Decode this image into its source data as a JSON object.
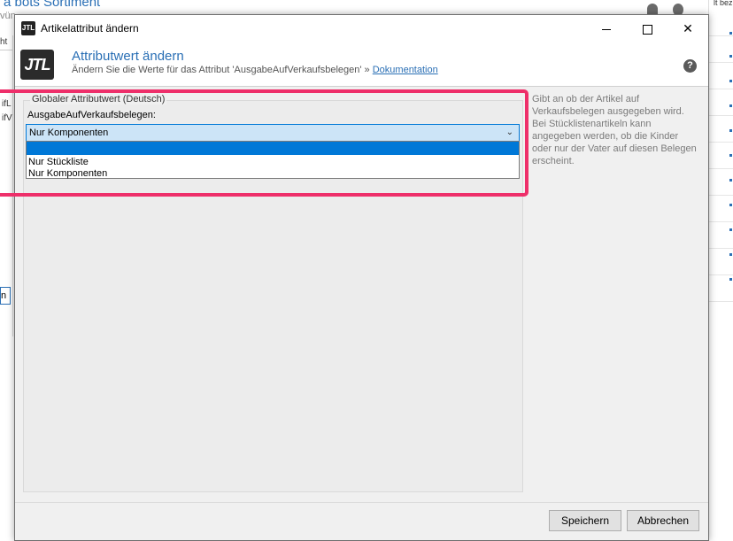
{
  "background": {
    "title": "a bots Sortiment",
    "subtitle": "vün",
    "left_button": "ht",
    "left_text_1": "ifL",
    "left_text_2": "ifV",
    "left_field": "n",
    "right_text": "lt bez"
  },
  "dialog": {
    "window_title": "Artikelattribut ändern",
    "logo_text": "JTL",
    "header": {
      "title": "Attributwert ändern",
      "subtitle": "Ändern Sie die Werte für das Attribut 'AusgabeAufVerkaufsbelegen'",
      "link_prefix": "»",
      "link": "Dokumentation"
    },
    "group_title": "Globaler Attributwert (Deutsch)",
    "field_label": "AusgabeAufVerkaufsbelegen:",
    "select": {
      "selected": "Nur Komponenten",
      "options": [
        "",
        "Nur Stückliste",
        "Nur Komponenten"
      ]
    },
    "description": "Gibt an ob der Artikel auf Verkaufsbelegen ausgegeben wird. Bei Stücklistenartikeln kann angegeben werden, ob die Kinder oder nur der Vater auf diesen Belegen erscheint.",
    "buttons": {
      "save": "Speichern",
      "cancel": "Abbrechen"
    }
  },
  "colors": {
    "accent": "#2a6fb5",
    "highlight": "#ee2f6a",
    "selection": "#0078d7"
  }
}
